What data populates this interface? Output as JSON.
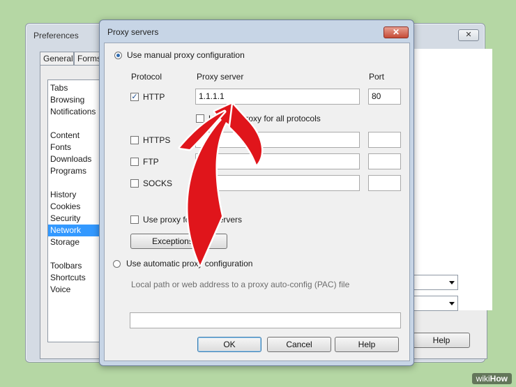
{
  "preferences": {
    "title": "Preferences",
    "close_label": "✕",
    "tabs": [
      "General",
      "Forms"
    ],
    "sections": [
      "Tabs",
      "Browsing",
      "Notifications",
      "Content",
      "Fonts",
      "Downloads",
      "Programs",
      "History",
      "Cookies",
      "Security",
      "Network",
      "Storage",
      "Toolbars",
      "Shortcuts",
      "Voice"
    ],
    "selected_section": "Network",
    "help_label": "Help"
  },
  "proxy_dialog": {
    "title": "Proxy servers",
    "close_label": "✕",
    "manual_option_label": "Use manual proxy configuration",
    "manual_selected": true,
    "header_protocol": "Protocol",
    "header_server": "Proxy server",
    "header_port": "Port",
    "rows": [
      {
        "protocol": "HTTP",
        "checked": true,
        "server": "1.1.1.1",
        "port": "80"
      },
      {
        "protocol": "HTTPS",
        "checked": false,
        "server": "",
        "port": ""
      },
      {
        "protocol": "FTP",
        "checked": false,
        "server": "",
        "port": ""
      },
      {
        "protocol": "SOCKS",
        "checked": false,
        "server": "",
        "port": ""
      }
    ],
    "use_for_all_label": "Use this proxy for all protocols",
    "use_for_local_label": "Use proxy for local servers",
    "exceptions_label": "Exceptions list",
    "auto_option_label": "Use automatic proxy configuration",
    "auto_selected": false,
    "pac_hint": "Local path or web address to a proxy auto-config (PAC) file",
    "pac_value": "",
    "ok_label": "OK",
    "cancel_label": "Cancel",
    "help_label": "Help"
  },
  "annotation": {
    "arrow_color": "#e0151b"
  },
  "watermark": {
    "prefix": "wiki",
    "suffix": "How"
  }
}
